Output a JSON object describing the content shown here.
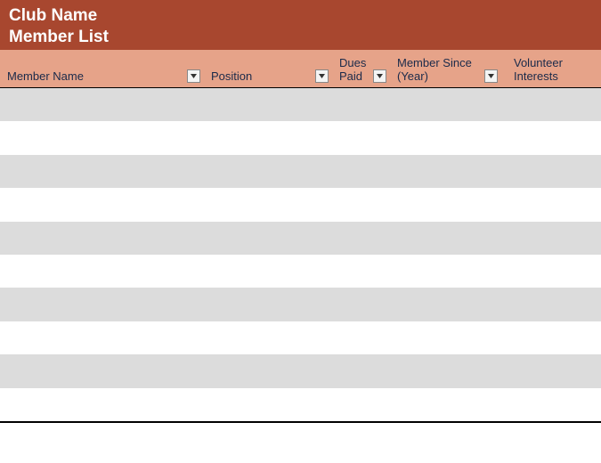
{
  "title": {
    "line1": "Club Name",
    "line2": "Member List"
  },
  "columns": {
    "member_name": "Member Name",
    "position": "Position",
    "dues_paid": "Dues\nPaid",
    "member_since": "Member Since\n(Year)",
    "volunteer_interests": "Volunteer Interests"
  },
  "rows": [
    {},
    {},
    {},
    {},
    {},
    {},
    {},
    {},
    {},
    {}
  ]
}
